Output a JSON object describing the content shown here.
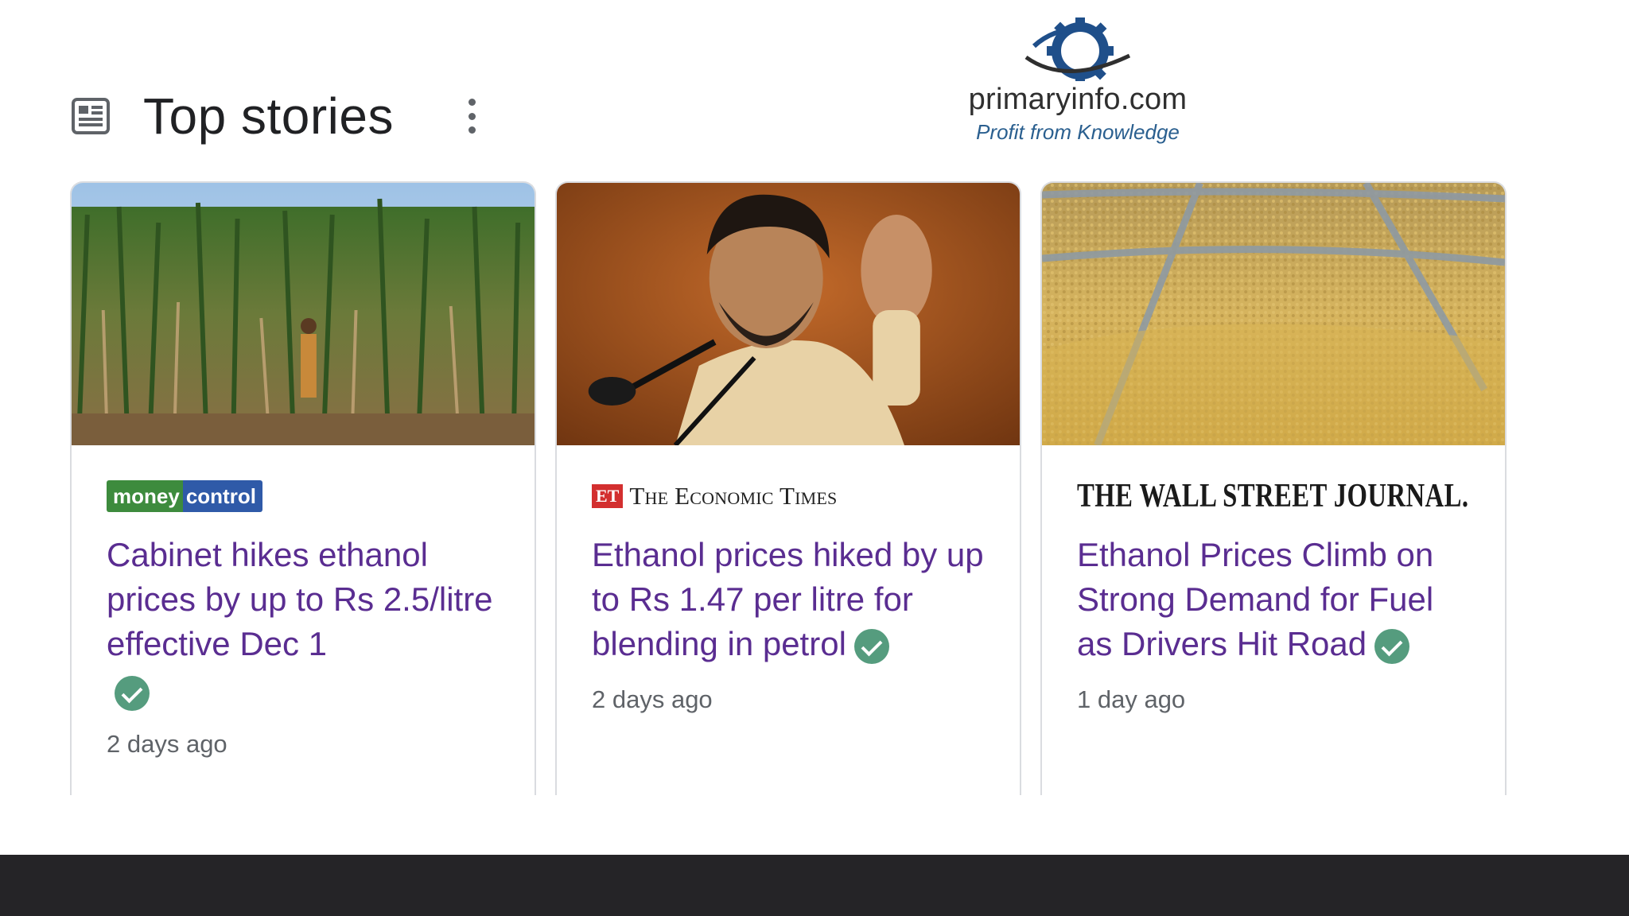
{
  "header": {
    "title": "Top stories",
    "icon": "news-icon",
    "more_icon": "more-vert-icon"
  },
  "watermark": {
    "name": "primaryinfo.com",
    "tagline": "Profit from Knowledge"
  },
  "stories": [
    {
      "source": {
        "part1": "money",
        "part2": "control"
      },
      "headline": "Cabinet hikes ethanol prices by up to Rs 2.5/litre effective Dec 1",
      "time": "2 days ago",
      "thumbnail": "sugarcane-field-image",
      "verified": true
    },
    {
      "source": {
        "badge": "ET",
        "name": "The Economic Times"
      },
      "headline": "Ethanol prices hiked by up to Rs 1.47 per litre for blending in petrol",
      "time": "2 days ago",
      "thumbnail": "speaker-at-podium-image",
      "verified": true
    },
    {
      "source": {
        "name": "THE WALL STREET JOURNAL."
      },
      "headline": "Ethanol Prices Climb on Strong Demand for Fuel as Drivers Hit Road",
      "time": "1 day ago",
      "thumbnail": "corn-grain-pile-image",
      "verified": true
    }
  ],
  "colors": {
    "headline": "#5a2d91",
    "verified": "#559c7e",
    "footer": "#252427"
  }
}
